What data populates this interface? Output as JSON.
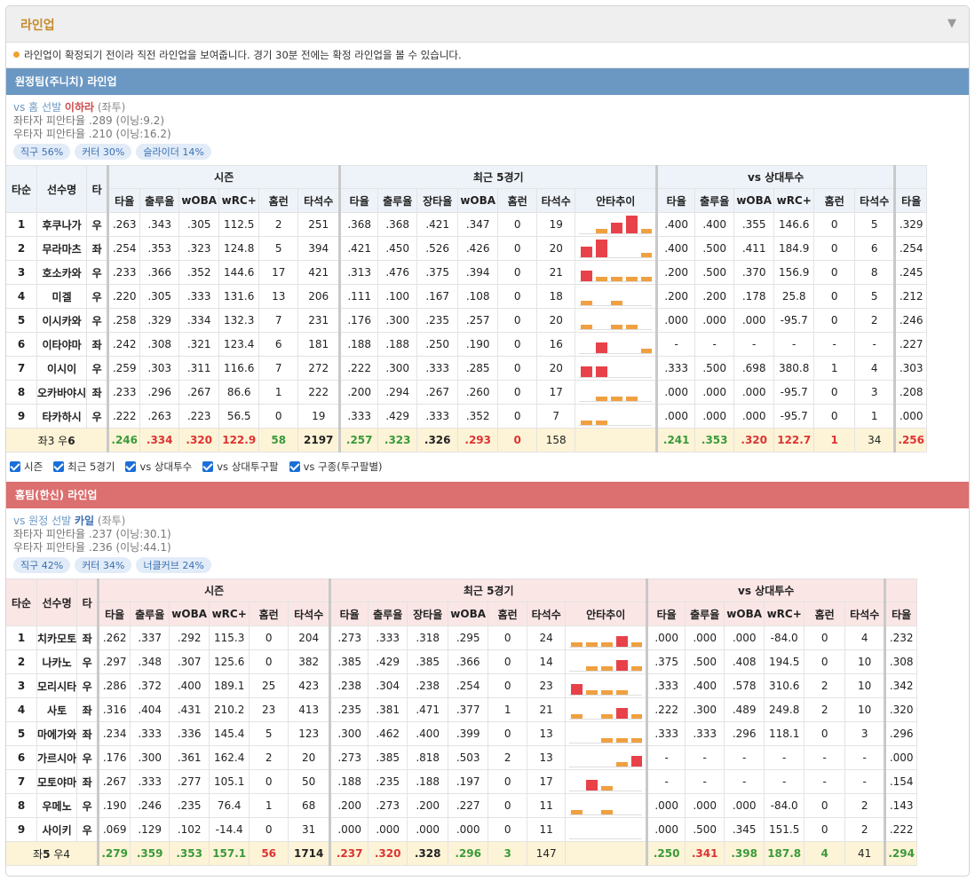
{
  "header": {
    "title": "라인업",
    "toggle": "▼"
  },
  "notice": "라인업이 확정되기 전이라 직전 라인업을 보여줍니다. 경기 30분 전에는 확정 라인업을 볼 수 있습니다.",
  "columns": {
    "order": "타순",
    "name": "선수명",
    "hand": "타",
    "season": "시즌",
    "recent": "최근 5경기",
    "vs": "vs 상대투수",
    "season_cols": [
      "타율",
      "출루율",
      "wOBA",
      "wRC+",
      "홈런",
      "타석수"
    ],
    "recent_cols": [
      "타율",
      "출루율",
      "장타율",
      "wOBA",
      "홈런",
      "타석수",
      "안타추이"
    ],
    "vs_cols": [
      "타율",
      "출루율",
      "wOBA",
      "wRC+",
      "홈런",
      "타석수"
    ],
    "extra": "타율"
  },
  "checks": [
    "시즌",
    "최근 5경기",
    "vs 상대투수",
    "vs 상대투구팔",
    "vs 구종(투구팔별)"
  ],
  "colors": {
    "away": "#6b98c3",
    "home": "#dc6f6f",
    "spark_high": "#e8414a",
    "spark_low": "#f0a040"
  },
  "away": {
    "bar": "원정팀(주니치) 라인업",
    "vs_prefix": "vs 홈 선발 ",
    "pitcher": "이하라",
    "pitcher_hand": "(좌투)",
    "line1": "좌타자 피안타율 .289 (이닝:9.2)",
    "line2": "우타자 피안타율 .210 (이닝:16.2)",
    "pills": [
      "직구 56%",
      "커터 30%",
      "슬라이더 14%"
    ],
    "rows": [
      {
        "n": "1",
        "name": "후쿠나가",
        "h": "우",
        "s": [
          ".263",
          ".343",
          ".305",
          "112.5",
          "2",
          "251"
        ],
        "r": [
          ".368",
          ".368",
          ".421",
          ".347",
          "0",
          "19"
        ],
        "spark": [
          0,
          1,
          2,
          3,
          1
        ],
        "v": [
          ".400",
          ".400",
          ".355",
          "146.6",
          "0",
          "5"
        ],
        "x": ".329"
      },
      {
        "n": "2",
        "name": "무라마츠",
        "h": "좌",
        "s": [
          ".254",
          ".353",
          ".323",
          "124.8",
          "5",
          "394"
        ],
        "r": [
          ".421",
          ".450",
          ".526",
          ".426",
          "0",
          "20"
        ],
        "spark": [
          2,
          3,
          0,
          0,
          1
        ],
        "v": [
          ".400",
          ".500",
          ".411",
          "184.9",
          "0",
          "6"
        ],
        "x": ".254"
      },
      {
        "n": "3",
        "name": "호소카와",
        "h": "우",
        "s": [
          ".233",
          ".366",
          ".352",
          "144.6",
          "17",
          "421"
        ],
        "r": [
          ".313",
          ".476",
          ".375",
          ".394",
          "0",
          "21"
        ],
        "spark": [
          2,
          1,
          1,
          1,
          1
        ],
        "v": [
          ".200",
          ".500",
          ".370",
          "156.9",
          "0",
          "8"
        ],
        "x": ".245"
      },
      {
        "n": "4",
        "name": "미겔",
        "h": "우",
        "s": [
          ".220",
          ".305",
          ".333",
          "131.6",
          "13",
          "206"
        ],
        "r": [
          ".111",
          ".100",
          ".167",
          ".108",
          "0",
          "18"
        ],
        "spark": [
          1,
          0,
          1,
          0,
          0
        ],
        "v": [
          ".200",
          ".200",
          ".178",
          "25.8",
          "0",
          "5"
        ],
        "x": ".212"
      },
      {
        "n": "5",
        "name": "이시카와",
        "h": "우",
        "s": [
          ".258",
          ".329",
          ".334",
          "132.3",
          "7",
          "231"
        ],
        "r": [
          ".176",
          ".300",
          ".235",
          ".257",
          "0",
          "20"
        ],
        "spark": [
          1,
          0,
          1,
          1,
          0
        ],
        "v": [
          ".000",
          ".000",
          ".000",
          "-95.7",
          "0",
          "2"
        ],
        "x": ".246"
      },
      {
        "n": "6",
        "name": "이타야마",
        "h": "좌",
        "s": [
          ".242",
          ".308",
          ".321",
          "123.4",
          "6",
          "181"
        ],
        "r": [
          ".188",
          ".188",
          ".250",
          ".190",
          "0",
          "16"
        ],
        "spark": [
          0,
          2,
          0,
          0,
          1
        ],
        "v": [
          "-",
          "-",
          "-",
          "-",
          "-",
          "-"
        ],
        "x": ".227"
      },
      {
        "n": "7",
        "name": "이시이",
        "h": "우",
        "s": [
          ".259",
          ".303",
          ".311",
          "116.6",
          "7",
          "272"
        ],
        "r": [
          ".222",
          ".300",
          ".333",
          ".285",
          "0",
          "20"
        ],
        "spark": [
          2,
          2,
          0,
          0,
          0
        ],
        "v": [
          ".333",
          ".500",
          ".698",
          "380.8",
          "1",
          "4"
        ],
        "x": ".303"
      },
      {
        "n": "8",
        "name": "오카바야시",
        "h": "좌",
        "s": [
          ".233",
          ".296",
          ".267",
          "86.6",
          "1",
          "222"
        ],
        "r": [
          ".200",
          ".294",
          ".267",
          ".260",
          "0",
          "17"
        ],
        "spark": [
          0,
          1,
          1,
          1,
          0
        ],
        "v": [
          ".000",
          ".000",
          ".000",
          "-95.7",
          "0",
          "3"
        ],
        "x": ".208"
      },
      {
        "n": "9",
        "name": "타카하시",
        "h": "우",
        "s": [
          ".222",
          ".263",
          ".223",
          "56.5",
          "0",
          "19"
        ],
        "r": [
          ".333",
          ".429",
          ".333",
          ".352",
          "0",
          "7"
        ],
        "spark": [
          1,
          1,
          0,
          0,
          0
        ],
        "v": [
          ".000",
          ".000",
          ".000",
          "-95.7",
          "0",
          "1"
        ],
        "x": ".000"
      }
    ],
    "total": {
      "label_l": "좌3 우",
      "label_b": "6",
      "s": [
        ".246",
        ".334",
        ".320",
        "122.9",
        "58",
        "2197"
      ],
      "r": [
        ".257",
        ".323",
        ".326",
        ".293",
        "0",
        "158"
      ],
      "v": [
        ".241",
        ".353",
        ".320",
        "122.7",
        "1",
        "34"
      ],
      "x": ".256"
    }
  },
  "home": {
    "bar": "홈팀(한신) 라인업",
    "vs_prefix": "vs 원정 선발 ",
    "pitcher": "카일",
    "pitcher_hand": "(좌투)",
    "line1": "좌타자 피안타율 .237 (이닝:30.1)",
    "line2": "우타자 피안타율 .236 (이닝:44.1)",
    "pills": [
      "직구 42%",
      "커터 34%",
      "너클커브 24%"
    ],
    "rows": [
      {
        "n": "1",
        "name": "치카모토",
        "h": "좌",
        "s": [
          ".262",
          ".337",
          ".292",
          "115.3",
          "0",
          "204"
        ],
        "r": [
          ".273",
          ".333",
          ".318",
          ".295",
          "0",
          "24"
        ],
        "spark": [
          1,
          1,
          1,
          2,
          1
        ],
        "v": [
          ".000",
          ".000",
          ".000",
          "-84.0",
          "0",
          "4"
        ],
        "x": ".232"
      },
      {
        "n": "2",
        "name": "나카노",
        "h": "우",
        "s": [
          ".297",
          ".348",
          ".307",
          "125.6",
          "0",
          "382"
        ],
        "r": [
          ".385",
          ".429",
          ".385",
          ".366",
          "0",
          "14"
        ],
        "spark": [
          0,
          1,
          1,
          2,
          1
        ],
        "v": [
          ".375",
          ".500",
          ".408",
          "194.5",
          "0",
          "10"
        ],
        "x": ".308"
      },
      {
        "n": "3",
        "name": "모리시타",
        "h": "우",
        "s": [
          ".286",
          ".372",
          ".400",
          "189.1",
          "25",
          "423"
        ],
        "r": [
          ".238",
          ".304",
          ".238",
          ".254",
          "0",
          "23"
        ],
        "spark": [
          2,
          1,
          1,
          1,
          0
        ],
        "v": [
          ".333",
          ".400",
          ".578",
          "310.6",
          "2",
          "10"
        ],
        "x": ".342"
      },
      {
        "n": "4",
        "name": "사토",
        "h": "좌",
        "s": [
          ".316",
          ".404",
          ".431",
          "210.2",
          "23",
          "413"
        ],
        "r": [
          ".235",
          ".381",
          ".471",
          ".377",
          "1",
          "21"
        ],
        "spark": [
          1,
          0,
          1,
          2,
          1
        ],
        "v": [
          ".222",
          ".300",
          ".489",
          "249.8",
          "2",
          "10"
        ],
        "x": ".320"
      },
      {
        "n": "5",
        "name": "마에가와",
        "h": "좌",
        "s": [
          ".234",
          ".333",
          ".336",
          "145.4",
          "5",
          "123"
        ],
        "r": [
          ".300",
          ".462",
          ".400",
          ".399",
          "0",
          "13"
        ],
        "spark": [
          0,
          0,
          1,
          1,
          1
        ],
        "v": [
          ".333",
          ".333",
          ".296",
          "118.1",
          "0",
          "3"
        ],
        "x": ".296"
      },
      {
        "n": "6",
        "name": "가르시아",
        "h": "우",
        "s": [
          ".176",
          ".300",
          ".361",
          "162.4",
          "2",
          "20"
        ],
        "r": [
          ".273",
          ".385",
          ".818",
          ".503",
          "2",
          "13"
        ],
        "spark": [
          0,
          0,
          0,
          1,
          2
        ],
        "v": [
          "-",
          "-",
          "-",
          "-",
          "-",
          "-"
        ],
        "x": ".000"
      },
      {
        "n": "7",
        "name": "모토야마",
        "h": "좌",
        "s": [
          ".267",
          ".333",
          ".277",
          "105.1",
          "0",
          "50"
        ],
        "r": [
          ".188",
          ".235",
          ".188",
          ".197",
          "0",
          "17"
        ],
        "spark": [
          0,
          2,
          1,
          0,
          0
        ],
        "v": [
          "-",
          "-",
          "-",
          "-",
          "-",
          "-"
        ],
        "x": ".154"
      },
      {
        "n": "8",
        "name": "우메노",
        "h": "우",
        "s": [
          ".190",
          ".246",
          ".235",
          "76.4",
          "1",
          "68"
        ],
        "r": [
          ".200",
          ".273",
          ".200",
          ".227",
          "0",
          "11"
        ],
        "spark": [
          1,
          0,
          1,
          0,
          0
        ],
        "v": [
          ".000",
          ".000",
          ".000",
          "-84.0",
          "0",
          "2"
        ],
        "x": ".143"
      },
      {
        "n": "9",
        "name": "사이키",
        "h": "우",
        "s": [
          ".069",
          ".129",
          ".102",
          "-14.4",
          "0",
          "31"
        ],
        "r": [
          ".000",
          ".000",
          ".000",
          ".000",
          "0",
          "11"
        ],
        "spark": [
          0,
          0,
          0,
          0,
          0
        ],
        "v": [
          ".000",
          ".500",
          ".345",
          "151.5",
          "0",
          "2"
        ],
        "x": ".222"
      }
    ],
    "total": {
      "label_l": "좌",
      "label_b": "5",
      "label_r": " 우4",
      "s": [
        ".279",
        ".359",
        ".353",
        "157.1",
        "56",
        "1714"
      ],
      "r": [
        ".237",
        ".320",
        ".328",
        ".296",
        "3",
        "147"
      ],
      "v": [
        ".250",
        ".341",
        ".398",
        "187.8",
        "4",
        "41"
      ],
      "x": ".294"
    }
  }
}
